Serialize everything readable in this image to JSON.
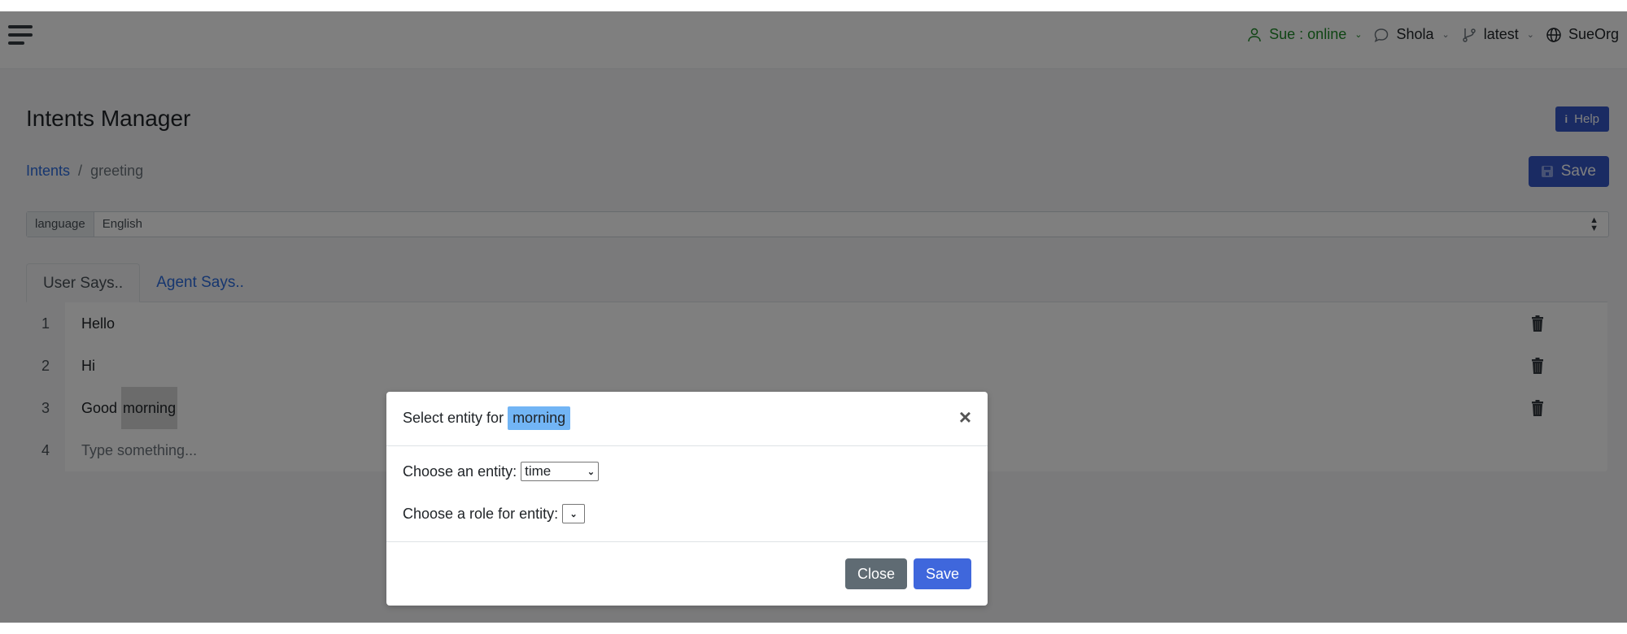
{
  "topbar": {
    "user_status": "Sue : online",
    "agent": "Shola",
    "version": "latest",
    "organization": "SueOrg"
  },
  "page": {
    "title": "Intents Manager",
    "help_label": "Help",
    "save_label": "Save",
    "breadcrumb": {
      "root": "Intents",
      "separator": "/",
      "current": "greeting"
    }
  },
  "language": {
    "label": "language",
    "selected": "English"
  },
  "tabs": [
    {
      "label": "User Says..",
      "active": true
    },
    {
      "label": "Agent Says..",
      "active": false
    }
  ],
  "user_says": [
    {
      "num": "1",
      "text": "Hello"
    },
    {
      "num": "2",
      "text": "Hi"
    },
    {
      "num": "3",
      "text_before": "Good ",
      "highlight": "morning"
    },
    {
      "num": "4",
      "placeholder": "Type something..."
    }
  ],
  "modal": {
    "title_prefix": "Select entity for",
    "selected_word": "morning",
    "entity_label": "Choose an entity:",
    "entity_value": "time",
    "role_label": "Choose a role for entity:",
    "role_value": "",
    "close_label": "Close",
    "save_label": "Save"
  },
  "colors": {
    "primary": "#3f67dc",
    "secondary": "#5f6b73",
    "status_online": "#1e8a28",
    "highlight": "#72b5f5"
  }
}
